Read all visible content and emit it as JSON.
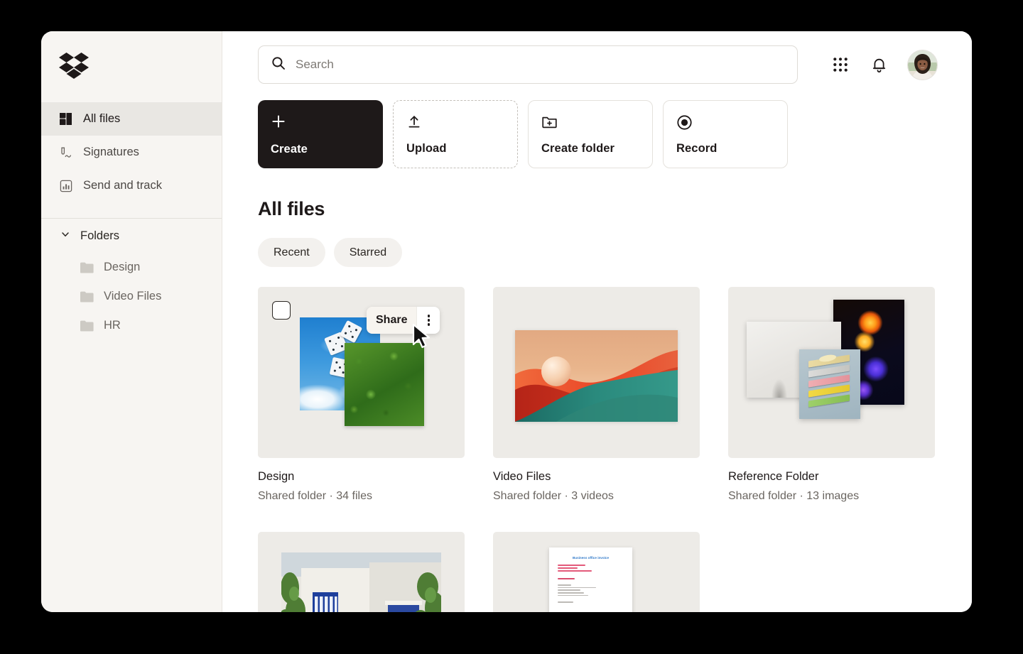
{
  "app": {
    "brand": "Dropbox",
    "logo_icon": "dropbox-logo-icon",
    "accent_dark": "#1e1919",
    "sidebar_bg": "#f7f5f2",
    "window_bg": "#ffffff",
    "page_bg": "#000000"
  },
  "sidebar": {
    "items": [
      {
        "label": "All files",
        "icon": "all-files-icon",
        "active": true
      },
      {
        "label": "Signatures",
        "icon": "signature-pen-icon",
        "active": false
      },
      {
        "label": "Send and track",
        "icon": "send-and-track-chart-icon",
        "active": false
      }
    ],
    "folders_section": {
      "label": "Folders",
      "chevron_icon": "chevron-down-icon",
      "expanded": true,
      "items": [
        {
          "label": "Design",
          "icon": "folder-icon"
        },
        {
          "label": "Video Files",
          "icon": "folder-icon"
        },
        {
          "label": "HR",
          "icon": "folder-icon"
        }
      ]
    }
  },
  "topbar": {
    "search": {
      "placeholder": "Search",
      "value": "",
      "icon": "search-icon"
    },
    "apps_grid_icon": "apps-grid-icon",
    "notifications_icon": "bell-icon",
    "avatar": {
      "icon": "avatar",
      "alt": "User profile photo"
    }
  },
  "actions": [
    {
      "label": "Create",
      "icon": "plus-icon",
      "style": "solid"
    },
    {
      "label": "Upload",
      "icon": "upload-arrow-icon",
      "style": "dashed"
    },
    {
      "label": "Create folder",
      "icon": "folder-plus-icon",
      "style": "outline"
    },
    {
      "label": "Record",
      "icon": "record-dot-icon",
      "style": "outline"
    }
  ],
  "content": {
    "title": "All files",
    "chips": [
      {
        "label": "Recent",
        "selected": false
      },
      {
        "label": "Starred",
        "selected": false
      }
    ],
    "hover_menu": {
      "share_label": "Share",
      "overflow_icon": "more-vertical-icon",
      "cursor_icon": "mouse-pointer-icon"
    },
    "cards": [
      {
        "name": "Design",
        "meta": "Shared folder · 34 files",
        "thumbnail": "dice-sky-and-moss-collage",
        "checkbox": {
          "icon": "checkbox-unchecked-icon",
          "checked": false
        },
        "has_hover_menu": true
      },
      {
        "name": "Video Files",
        "meta": "Shared folder · 3 videos",
        "thumbnail": "abstract-wave-sphere-render",
        "has_hover_menu": false
      },
      {
        "name": "Reference Folder",
        "meta": "Shared folder · 13 images",
        "thumbnail": "photo-stack-vr-neon-layers",
        "has_hover_menu": false
      }
    ],
    "partial_cards": [
      {
        "thumbnail": "white-house-blue-shutters-photo"
      },
      {
        "thumbnail": "document-preview-page"
      }
    ],
    "document_preview": {
      "title": "Business office invoice"
    }
  }
}
